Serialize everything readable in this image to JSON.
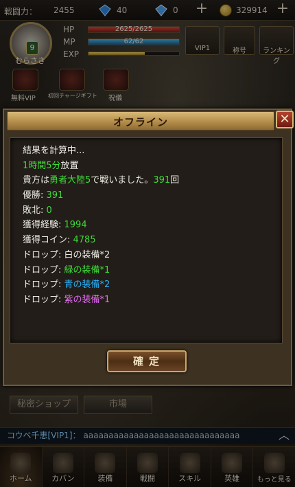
{
  "top_bar": {
    "power_label": "戦闘力：",
    "power_value": "2455",
    "gems_value": "40",
    "bound_gems_value": "0",
    "coins_value": "329914"
  },
  "player": {
    "level": "9",
    "name": "むらさき",
    "hp_label": "HP",
    "hp_value": "2625/2625",
    "mp_label": "MP",
    "mp_value": "62/62",
    "exp_label": "EXP",
    "exp_progress": 0.62,
    "hp_progress": 1.0,
    "mp_progress": 1.0
  },
  "top_buttons": {
    "vip": "VIP1",
    "title": "称号",
    "ranking": "ランキング"
  },
  "shortcuts": [
    {
      "label": "無料VIP"
    },
    {
      "label": "初回チャージギフト"
    },
    {
      "label": "祝儀"
    }
  ],
  "menu_buttons": {
    "secret_shop": "秘密ショップ",
    "market": "市場"
  },
  "chat": {
    "channel": "コウベ千恵[VIP1]：",
    "message": "aaaaaaaaaaaaaaaaaaaaaaaaaaaaaaa"
  },
  "bottom_nav": [
    {
      "label": "ホーム",
      "icon": "home-icon",
      "active": true
    },
    {
      "label": "カバン",
      "icon": "bag-icon"
    },
    {
      "label": "装備",
      "icon": "equipment-icon"
    },
    {
      "label": "戦闘",
      "icon": "battle-icon"
    },
    {
      "label": "スキル",
      "icon": "skill-icon"
    },
    {
      "label": "英雄",
      "icon": "hero-icon"
    },
    {
      "label": "もっと見る",
      "icon": "more-icon"
    }
  ],
  "modal": {
    "title": "オフライン",
    "close_symbol": "✕",
    "confirm_label": "確定",
    "lines": {
      "l1": "結果を計算中...",
      "l2_time": "1時間5分",
      "l2_rest": "放置",
      "l3_pre": "貴方は",
      "l3_place": "勇者大陸5",
      "l3_mid": "で戦いました。",
      "l3_count": "391",
      "l3_post": "回",
      "win_label": "優勝: ",
      "win_value": "391",
      "lose_label": "敗北: ",
      "lose_value": "0",
      "exp_label": "獲得経験: ",
      "exp_value": "1994",
      "coin_label": "獲得コイン: ",
      "coin_value": "4785",
      "drop_label": "ドロップ: ",
      "drop_white": "白の装備*2",
      "drop_green": "緑の装備*1",
      "drop_blue": "青の装備*2",
      "drop_purple": "紫の装備*1"
    }
  },
  "colors": {
    "green": "#3fdc3a",
    "cyan": "#27b3ff",
    "magenta": "#e56af4",
    "header_gold": "#c9a86a"
  }
}
